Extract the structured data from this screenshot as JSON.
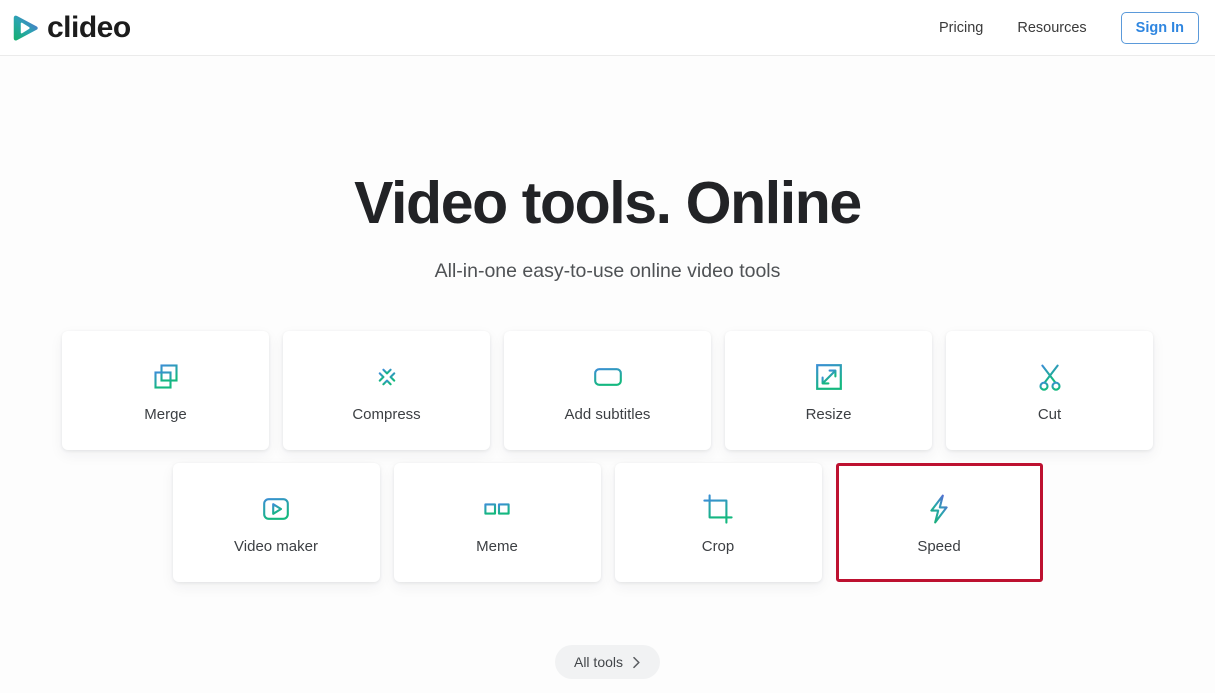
{
  "header": {
    "logo": {
      "icon": "play-triangle-logo-icon",
      "name": "clideo"
    },
    "nav_links": [
      {
        "label": "Pricing",
        "name": "nav-link-pricing"
      },
      {
        "label": "Resources",
        "name": "nav-link-resources"
      }
    ],
    "sign_in_label": "Sign In"
  },
  "hero": {
    "title": "Video tools. Online",
    "subtitle": "All-in-one easy-to-use online video tools"
  },
  "tools": {
    "row1": [
      {
        "label": "Merge",
        "icon": "merge-squares-icon"
      },
      {
        "label": "Compress",
        "icon": "compress-arrows-icon"
      },
      {
        "label": "Add subtitles",
        "icon": "subtitles-icon"
      },
      {
        "label": "Resize",
        "icon": "resize-expand-icon"
      },
      {
        "label": "Cut",
        "icon": "scissors-icon"
      }
    ],
    "row2": [
      {
        "label": "Video maker",
        "icon": "video-play-icon"
      },
      {
        "label": "Meme",
        "icon": "glasses-icon"
      },
      {
        "label": "Crop",
        "icon": "crop-icon"
      },
      {
        "label": "Speed",
        "icon": "lightning-bolt-icon",
        "highlighted": true
      }
    ]
  },
  "footer": {
    "all_tools_label": "All tools",
    "chevron_icon": "chevron-right-icon"
  },
  "colors": {
    "icon_gradient_start": "#3a8fd4",
    "icon_gradient_end": "#14b87f",
    "highlight_border": "#bd1130",
    "signin_blue": "#2f86e0",
    "heading": "#222326",
    "page_background": "#fdfdfd"
  }
}
